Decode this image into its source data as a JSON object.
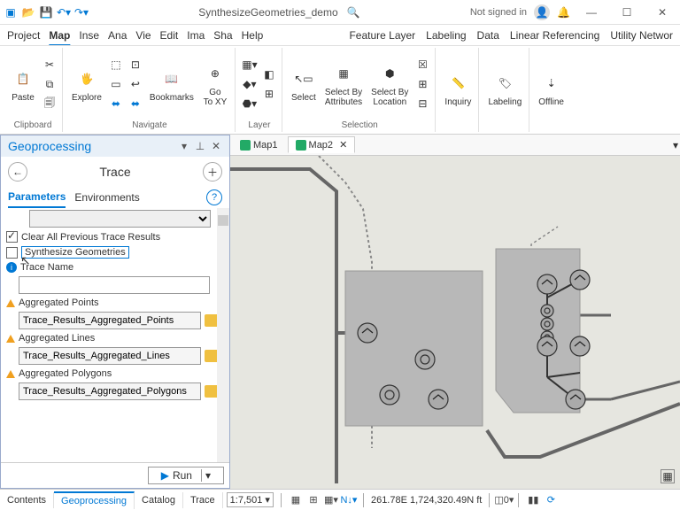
{
  "titlebar": {
    "title": "SynthesizeGeometries_demo",
    "signin": "Not signed in"
  },
  "menu": {
    "items": [
      "Project",
      "Map",
      "Inse",
      "Ana",
      "Vie",
      "Edit",
      "Ima",
      "Sha",
      "Help"
    ],
    "right": [
      "Feature Layer",
      "Labeling",
      "Data",
      "Linear Referencing",
      "Utility Networ"
    ]
  },
  "ribbon": {
    "paste": "Paste",
    "explore": "Explore",
    "bookmarks": "Bookmarks",
    "goto": "Go\nTo XY",
    "select": "Select",
    "selattr": "Select By\nAttributes",
    "selloc": "Select By\nLocation",
    "inquiry": "Inquiry",
    "labeling": "Labeling",
    "offline": "Offline",
    "g_clip": "Clipboard",
    "g_nav": "Navigate",
    "g_layer": "Layer",
    "g_sel": "Selection"
  },
  "pane": {
    "title": "Geoprocessing",
    "tool": "Trace",
    "tab_params": "Parameters",
    "tab_env": "Environments",
    "clear_prev": "Clear All Previous Trace Results",
    "synth": "Synthesize Geometries",
    "trace_name": "Trace Name",
    "agg_pts": "Aggregated Points",
    "agg_pts_v": "Trace_Results_Aggregated_Points",
    "agg_lines": "Aggregated Lines",
    "agg_lines_v": "Trace_Results_Aggregated_Lines",
    "agg_poly": "Aggregated Polygons",
    "agg_poly_v": "Trace_Results_Aggregated_Polygons",
    "run": "Run"
  },
  "maps": {
    "tab1": "Map1",
    "tab2": "Map2"
  },
  "bottom": {
    "contents": "Contents",
    "geoproc": "Geoprocessing",
    "catalog": "Catalog",
    "trace": "Trace"
  },
  "status": {
    "scale": "1:7,501",
    "coords": "261.78E 1,724,320.49N ft"
  }
}
